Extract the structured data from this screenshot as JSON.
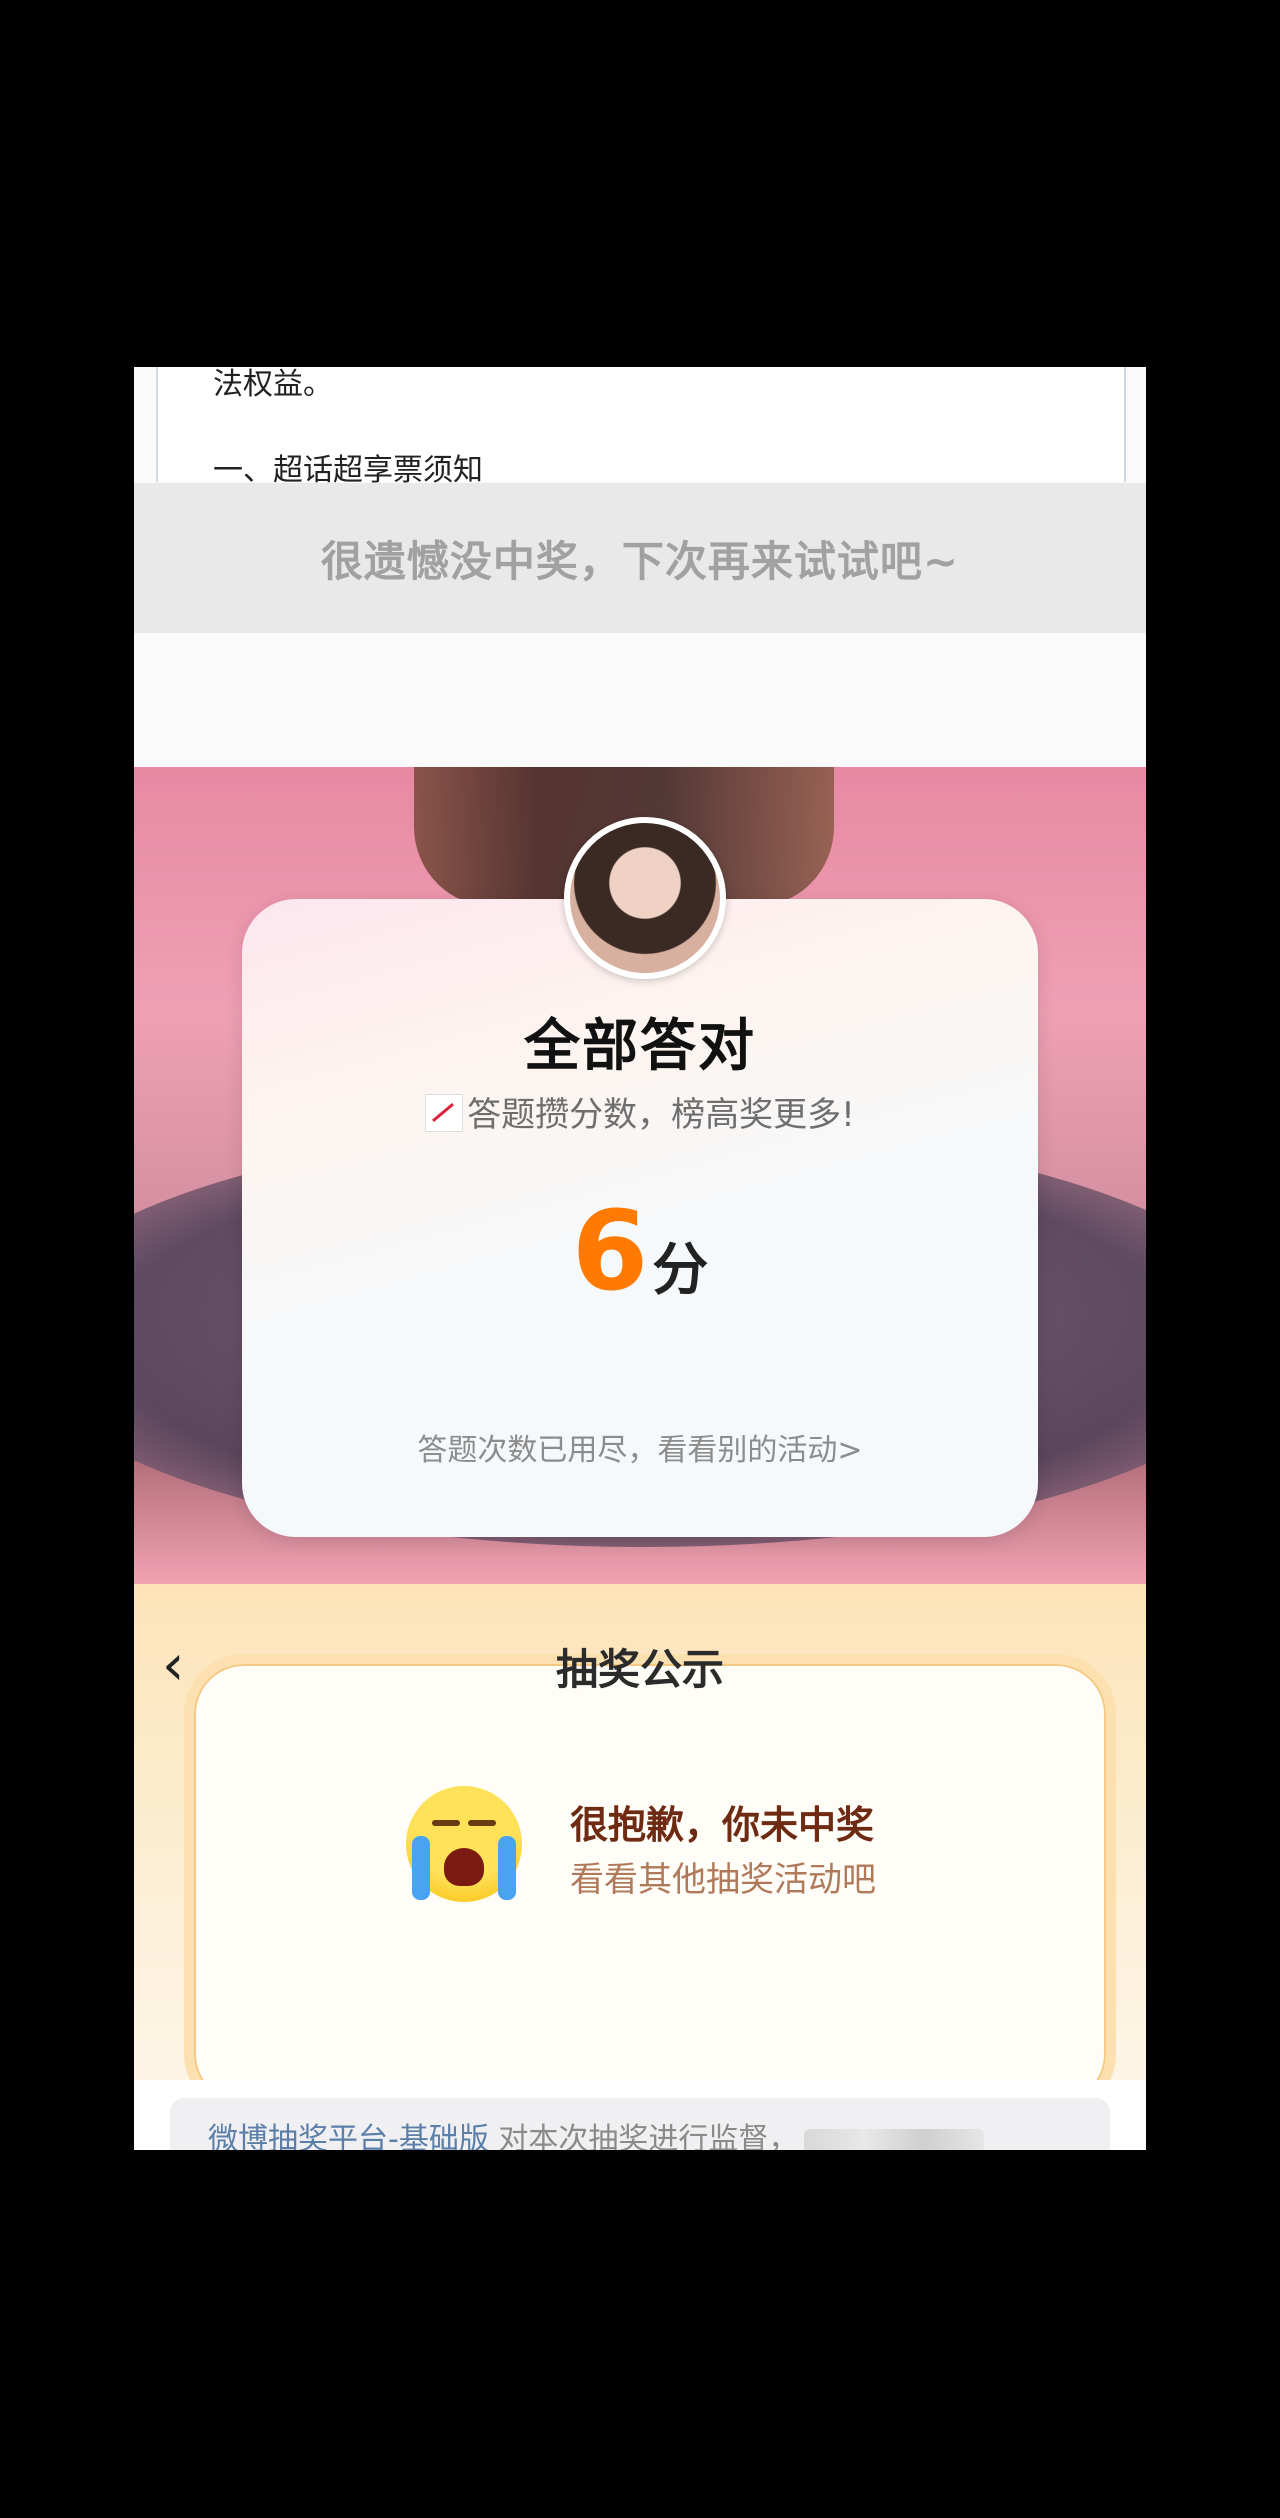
{
  "doc": {
    "line1": "法权益。",
    "line2": "一、超话超享票须知"
  },
  "banner": {
    "text": "很遗憾没中奖，下次再来试试吧~"
  },
  "quiz": {
    "title": "全部答对",
    "subtitle": "答题攒分数，榜高奖更多!",
    "score_value": "6",
    "score_unit": "分",
    "link": "答题次数已用尽，看看别的活动>"
  },
  "lottery": {
    "title": "抽奖公示",
    "headline": "很抱歉，你未中奖",
    "subline": "看看其他抽奖活动吧",
    "footer_link": "微博抽奖平台-基础版",
    "footer_text": " 对本次抽奖进行监督，"
  },
  "colors": {
    "score": "#ff7a00",
    "footer_link": "#5b7fa8",
    "headline": "#6e2a12"
  },
  "icons": [
    "chart-increasing-icon",
    "back-chevron-icon",
    "crying-face-icon",
    "avatar-image"
  ]
}
